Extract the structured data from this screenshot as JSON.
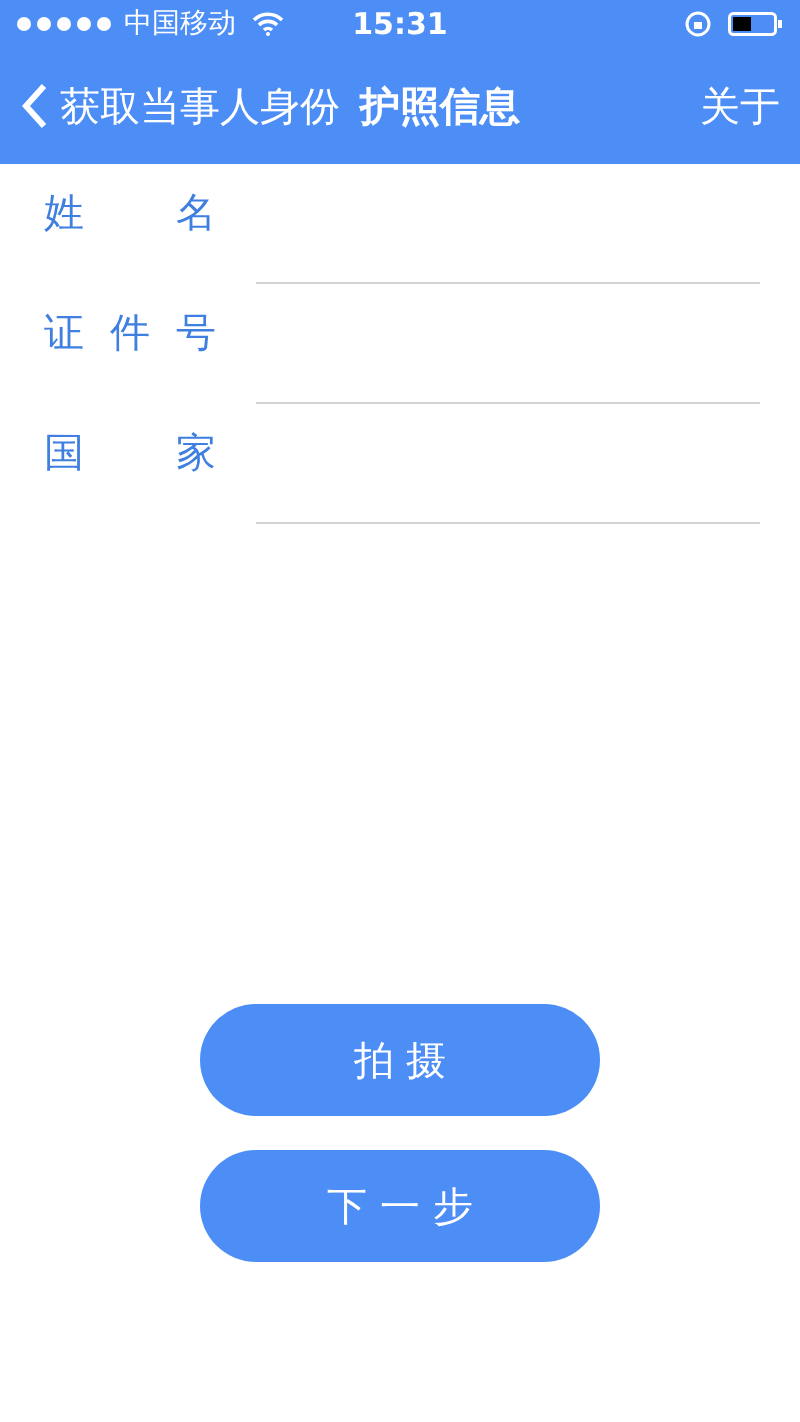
{
  "status_bar": {
    "carrier": "中国移动",
    "time": "15:31"
  },
  "nav": {
    "back_title": "获取当事人身份",
    "title": "护照信息",
    "action": "关于"
  },
  "fields": [
    {
      "label": "姓 名"
    },
    {
      "label": "证 件 号"
    },
    {
      "label": "国 家"
    }
  ],
  "buttons": [
    "拍 摄",
    "下 一 步"
  ]
}
